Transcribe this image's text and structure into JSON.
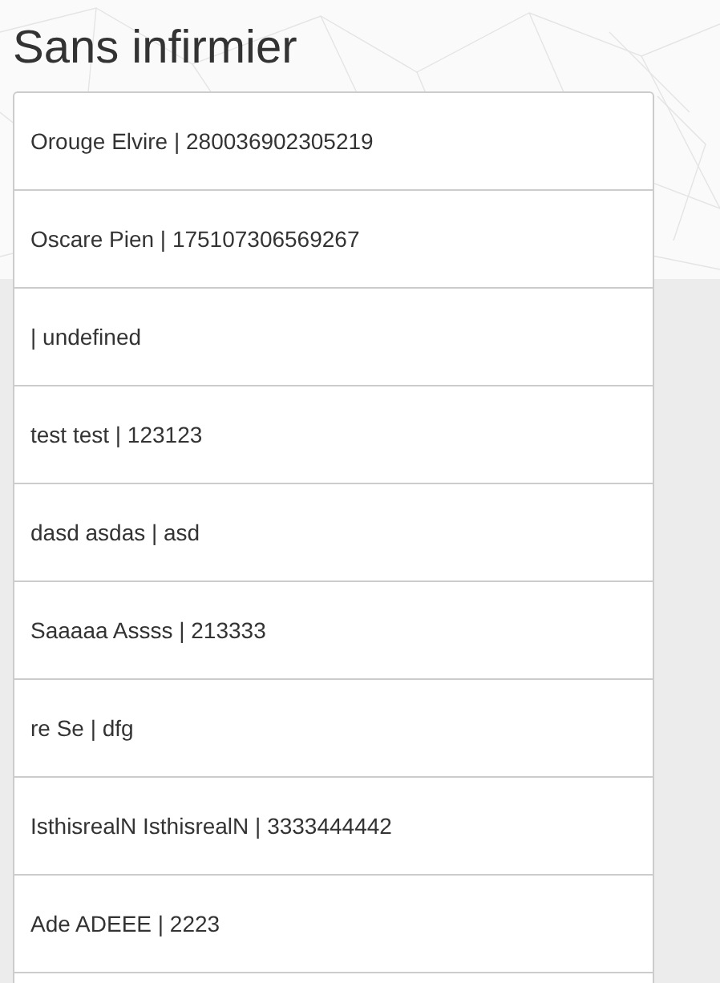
{
  "title": "Sans infirmier",
  "items": [
    {
      "label": "Orouge Elvire | 280036902305219"
    },
    {
      "label": "Oscare Pien | 175107306569267"
    },
    {
      "label": "| undefined"
    },
    {
      "label": "test test | 123123"
    },
    {
      "label": "dasd asdas | asd"
    },
    {
      "label": "Saaaaa Assss | 213333"
    },
    {
      "label": "re Se | dfg"
    },
    {
      "label": "IsthisrealN IsthisrealN | 3333444442"
    },
    {
      "label": "Ade ADEEE | 2223"
    }
  ]
}
